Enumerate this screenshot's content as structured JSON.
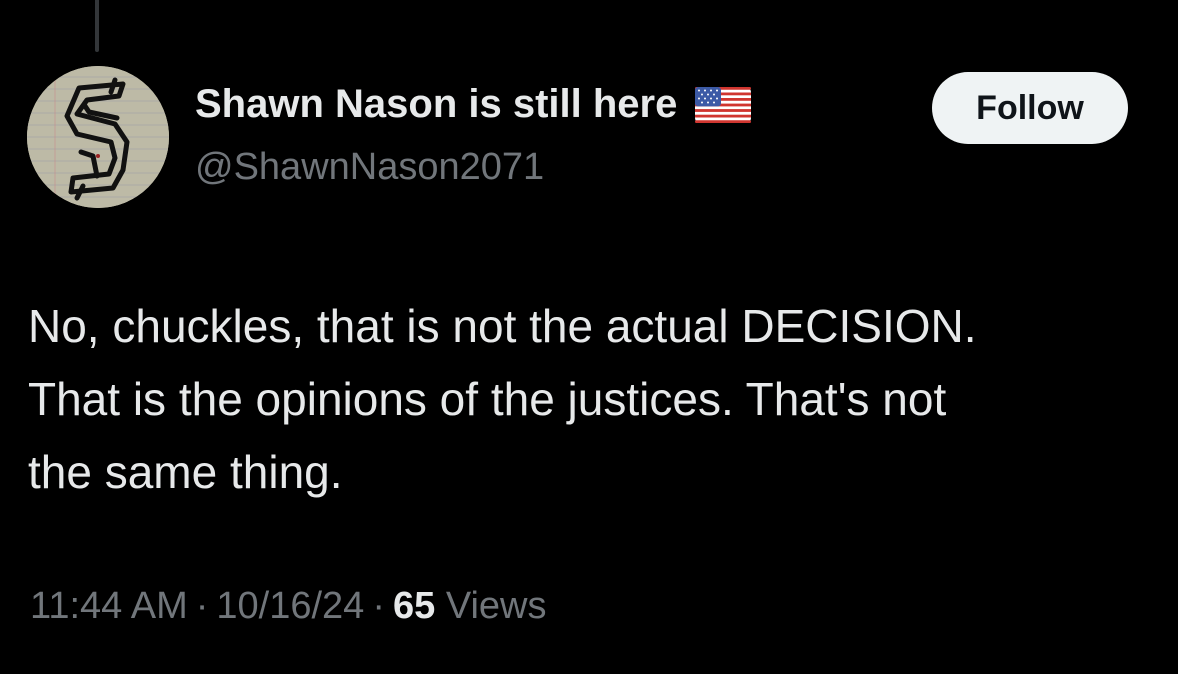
{
  "tweet": {
    "author": {
      "display_name": "Shawn Nason is still here",
      "handle": "@ShawnNason2071",
      "badge_icon": "us-flag-icon",
      "avatar_icon": "gothic-letter-s-icon"
    },
    "follow_label": "Follow",
    "text_lines": [
      "No, chuckles, that is not the actual DECISION.",
      "That is the opinions of the justices. That's not",
      "the same thing."
    ],
    "meta": {
      "time": "11:44 AM",
      "separator": "·",
      "date": "10/16/24",
      "views_count": "65",
      "views_label": "Views"
    }
  },
  "colors": {
    "background": "#000000",
    "primary_text": "#e7e9ea",
    "secondary_text": "#71767b",
    "follow_button_bg": "#eff3f4",
    "follow_button_text": "#0f1419",
    "thread_line": "#333639"
  }
}
